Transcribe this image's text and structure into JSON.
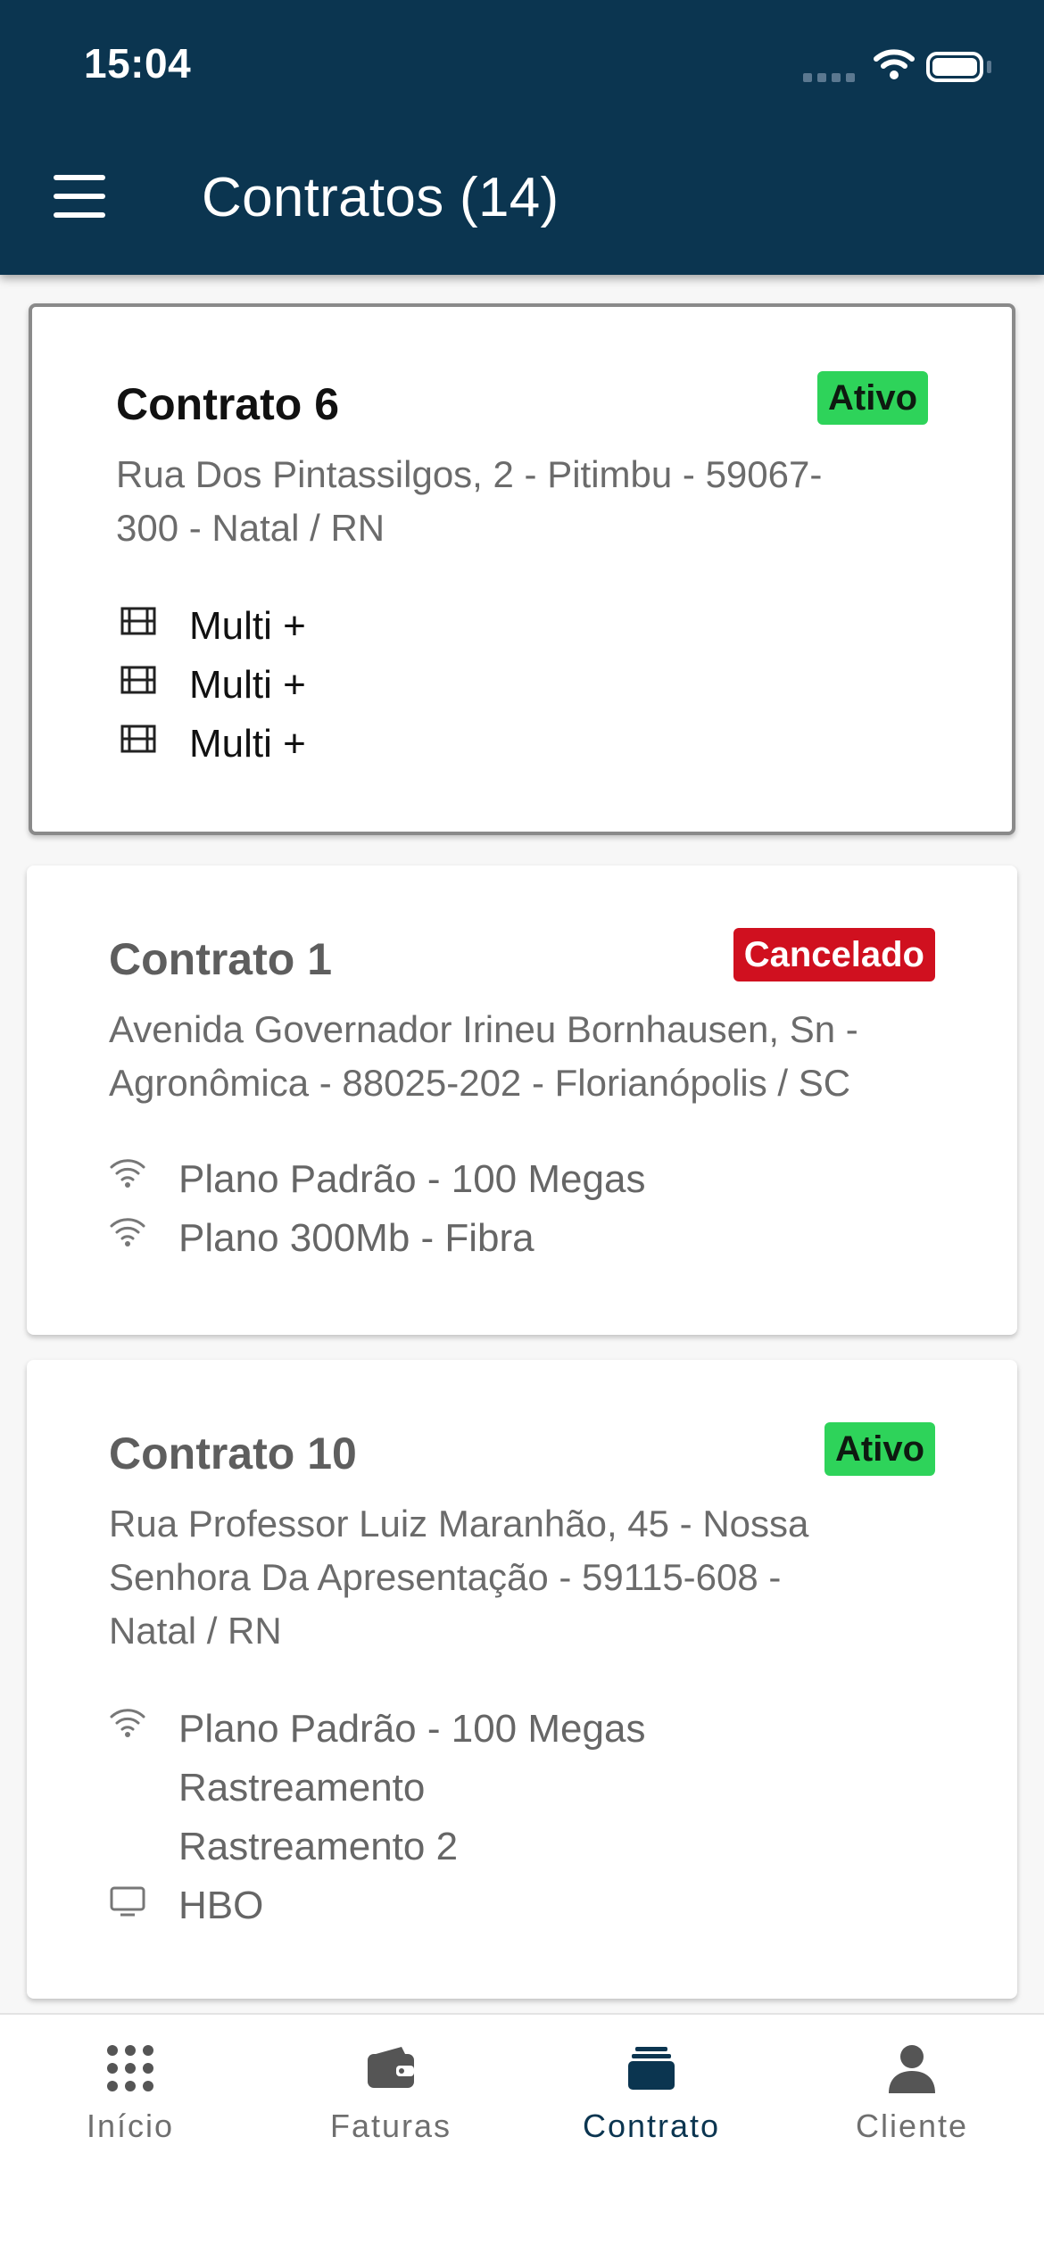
{
  "status_bar": {
    "time": "15:04"
  },
  "header": {
    "title": "Contratos (14)"
  },
  "colors": {
    "header_bg": "#0b3550",
    "badge_active": "#2ed35a",
    "badge_cancelled": "#d0101f",
    "tab_active": "#0b3550"
  },
  "contracts": [
    {
      "title": "Contrato 6",
      "status": "Ativo",
      "address_line1": "Rua Dos Pintassilgos, 2 - Pitimbu - 59067-",
      "address_line2": "300 - Natal / RN",
      "services": [
        {
          "icon": "film-icon",
          "label": "Multi +"
        },
        {
          "icon": "film-icon",
          "label": "Multi +"
        },
        {
          "icon": "film-icon",
          "label": "Multi +"
        }
      ]
    },
    {
      "title": "Contrato 1",
      "status": "Cancelado",
      "address_line1": "Avenida Governador Irineu Bornhausen, Sn -",
      "address_line2": "Agronômica - 88025-202 - Florianópolis / SC",
      "services": [
        {
          "icon": "wifi-icon",
          "label": "Plano Padrão - 100 Megas"
        },
        {
          "icon": "wifi-icon",
          "label": "Plano 300Mb - Fibra"
        }
      ]
    },
    {
      "title": "Contrato 10",
      "status": "Ativo",
      "address_line1": "Rua Professor Luiz Maranhão, 45 - Nossa",
      "address_line2": "Senhora Da Apresentação - 59115-608 -",
      "address_line3": "Natal / RN",
      "services": [
        {
          "icon": "wifi-icon",
          "label": "Plano Padrão - 100 Megas"
        },
        {
          "icon": "",
          "label": "Rastreamento"
        },
        {
          "icon": "",
          "label": "Rastreamento 2"
        },
        {
          "icon": "tv-icon",
          "label": "HBO"
        }
      ]
    }
  ],
  "tabbar": {
    "items": [
      {
        "label": "Início",
        "icon": "grid-icon"
      },
      {
        "label": "Faturas",
        "icon": "wallet-icon"
      },
      {
        "label": "Contrato",
        "icon": "stack-icon",
        "active": true
      },
      {
        "label": "Cliente",
        "icon": "person-icon"
      }
    ]
  }
}
